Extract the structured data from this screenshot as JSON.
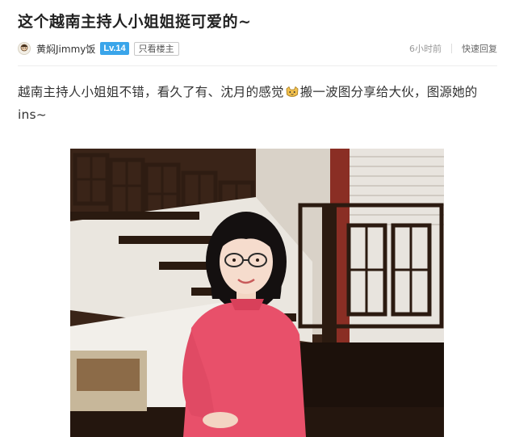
{
  "post": {
    "title": "这个越南主持人小姐姐挺可爱的~",
    "author": {
      "name": "黄焖Jimmy饭",
      "level": "Lv.14",
      "avatar_icon": "avatar-icon"
    },
    "only_op_label": "只看楼主",
    "time": "6小时前",
    "reply_label": "快速回复",
    "content_part1": "越南主持人小姐姐不错，看久了有、沈月的感觉",
    "content_emoji": "cat-face-emoji",
    "content_part2": "搬一波图分享给大伙，图源她的ins~",
    "image_icon": "photo-woman-staircase"
  },
  "colors": {
    "level_badge": "#3aa5ea",
    "dress": "#e8506a",
    "divider": "#eeeeee"
  }
}
